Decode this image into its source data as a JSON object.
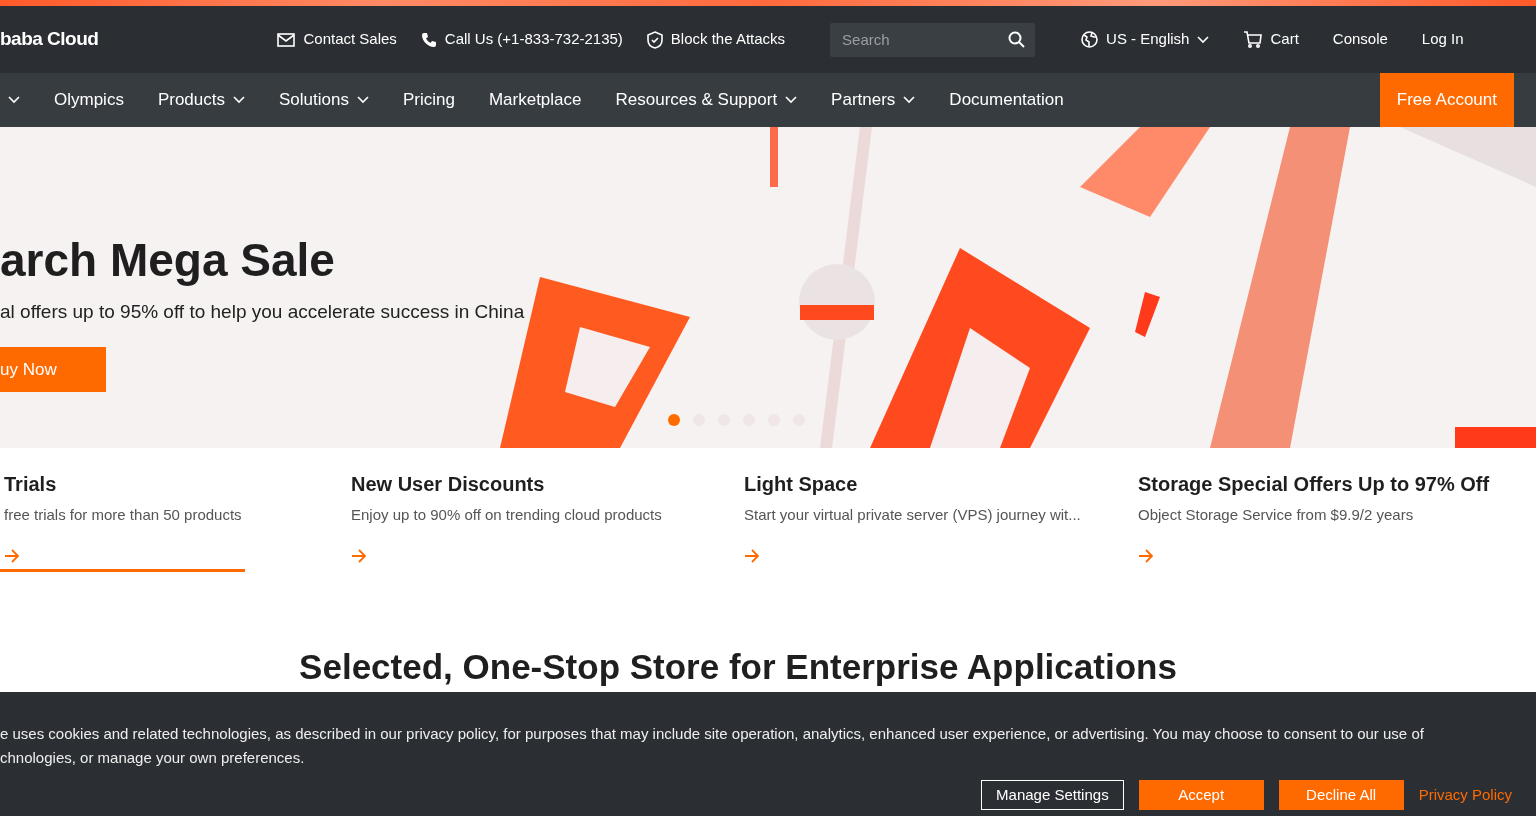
{
  "top_bar": {
    "logo": "baba Cloud",
    "links": [
      {
        "kind": "mail",
        "label": "Contact Sales"
      },
      {
        "kind": "phone",
        "label": "Call Us (+1-833-732-2135)"
      },
      {
        "kind": "shield",
        "label": "Block the Attacks"
      }
    ],
    "search": {
      "placeholder": "Search"
    },
    "right_links": [
      {
        "kind": "globe",
        "label": "US - English",
        "dropdown": true
      },
      {
        "kind": "cart",
        "label": "Cart",
        "dropdown": false
      },
      {
        "kind": "none",
        "label": "Console",
        "dropdown": false
      },
      {
        "kind": "none",
        "label": "Log In",
        "dropdown": false
      }
    ]
  },
  "nav": {
    "items": [
      {
        "dropdown": true
      },
      {
        "label": "Olympics",
        "dropdown": false
      },
      {
        "label": "Products",
        "dropdown": true
      },
      {
        "label": "Solutions",
        "dropdown": true
      },
      {
        "label": "Pricing",
        "dropdown": false
      },
      {
        "label": "Marketplace",
        "dropdown": false
      },
      {
        "label": "Resources & Support",
        "dropdown": true
      },
      {
        "label": "Partners",
        "dropdown": true
      },
      {
        "label": "Documentation",
        "dropdown": false
      }
    ],
    "cta": "Free Account"
  },
  "hero": {
    "title": "arch Mega Sale",
    "subtitle": "al offers up to 95% off to help you accelerate success in China",
    "button": "uy Now",
    "dots": [
      {
        "selected": true
      },
      {
        "selected": false
      },
      {
        "selected": false
      },
      {
        "selected": false
      },
      {
        "selected": false
      },
      {
        "selected": false
      }
    ]
  },
  "feature_cards": [
    {
      "title": "Trials",
      "text": "free trials for more than 50 products",
      "selected": true
    },
    {
      "title": "New User Discounts",
      "text": "Enjoy up to 90% off on trending cloud products",
      "selected": false
    },
    {
      "title": "Light Space",
      "text": "Start your virtual private server (VPS) journey wit...",
      "selected": false
    },
    {
      "title": "Storage Special Offers Up to 97% Off",
      "text": "Object Storage Service from $9.9/2 years",
      "selected": false
    }
  ],
  "section_heading": "Selected, One-Stop Store for Enterprise Applications",
  "cookie_banner": {
    "lines": [
      "e uses cookies and related technologies, as described in our privacy policy, for purposes that may include site operation, analytics, enhanced user experience, or advertising. You may choose to consent to our use of",
      "chnologies, or manage your own preferences."
    ],
    "buttons": [
      {
        "kind": "outline",
        "label": "Manage Settings"
      },
      {
        "kind": "solid",
        "label": "Accept"
      },
      {
        "kind": "solid",
        "label": "Decline All"
      },
      {
        "kind": "link",
        "label": "Privacy Policy"
      }
    ]
  }
}
